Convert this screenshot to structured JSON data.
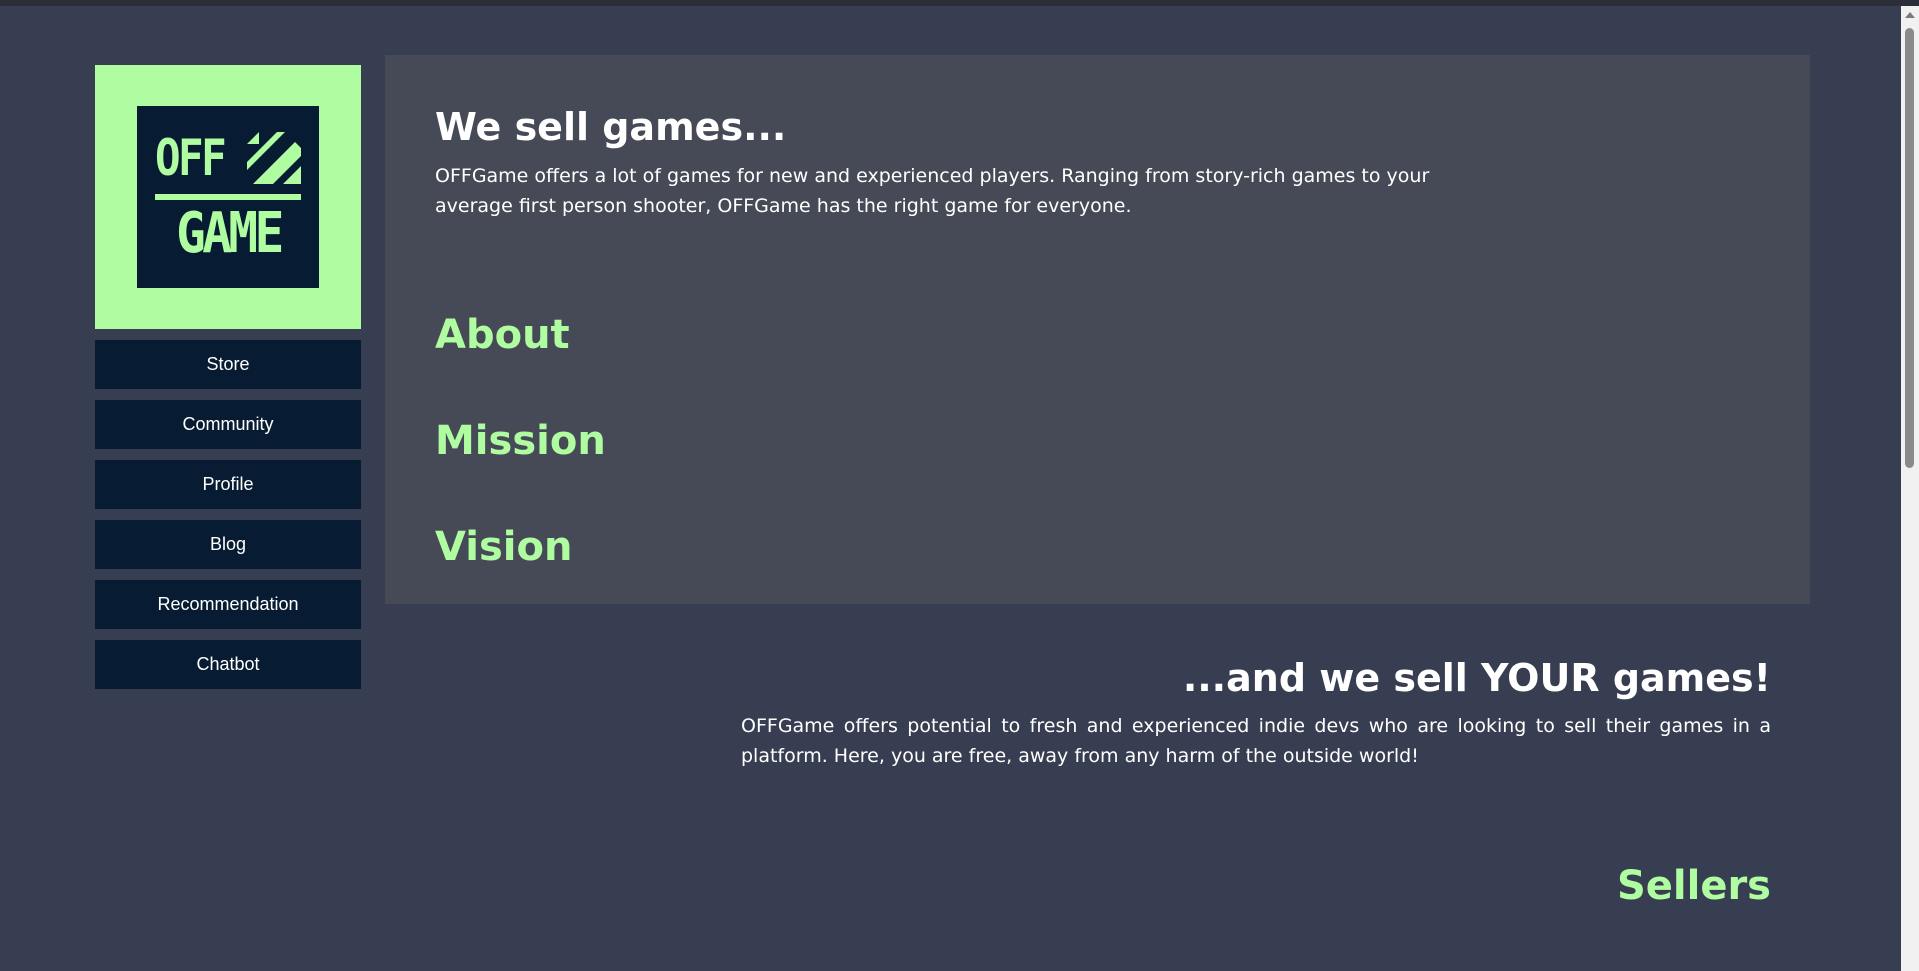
{
  "logo": {
    "line1": "OFF",
    "line2": "GAME"
  },
  "nav": {
    "items": [
      {
        "label": "Store"
      },
      {
        "label": "Community"
      },
      {
        "label": "Profile"
      },
      {
        "label": "Blog"
      },
      {
        "label": "Recommendation"
      },
      {
        "label": "Chatbot"
      }
    ]
  },
  "hero": {
    "title": "We sell games...",
    "text": "OFFGame offers a lot of games for new and experienced players. Ranging from story-rich games to your average first person shooter, OFFGame has the right game for everyone."
  },
  "sections": [
    {
      "label": "About"
    },
    {
      "label": "Mission"
    },
    {
      "label": "Vision"
    }
  ],
  "sell": {
    "title": "...and we sell YOUR games!",
    "text": "OFFGame offers potential to fresh and experienced indie devs who are looking to sell their games in a platform. Here, you are free, away from any harm of the outside world!",
    "link": "Sellers"
  },
  "colors": {
    "background": "#383e52",
    "panel": "#464a56",
    "accent": "#b0fca0",
    "nav_bg": "#071c33"
  }
}
